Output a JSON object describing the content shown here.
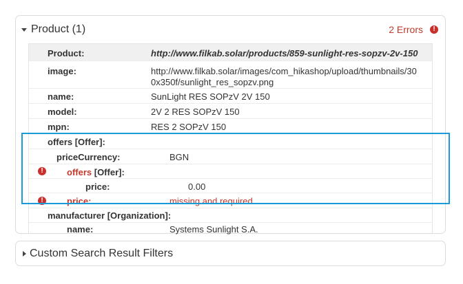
{
  "product_panel": {
    "title": "Product (1)",
    "errors_label": "2 Errors",
    "rows": {
      "product": {
        "label": "Product:",
        "value": "http://www.filkab.solar/products/859-sunlight-res-sopzv-2v-150"
      },
      "image": {
        "label": "image:",
        "value_line1": "http://www.filkab.solar/images/com_hikashop/upload/thumbnails/30",
        "value_line2": "0x350f/sunlight_res_sopzv.png"
      },
      "name": {
        "label": "name:",
        "value": "SunLight RES SOPzV 2V 150"
      },
      "model": {
        "label": "model:",
        "value": "2V 2 RES SOPzV 150"
      },
      "mpn": {
        "label": "mpn:",
        "value": "RES 2 SOPzV 150"
      },
      "offers": {
        "label": "offers [Offer]:"
      },
      "price_currency": {
        "label": "priceCurrency:",
        "value": "BGN"
      },
      "nested_offers": {
        "label_red": "offers",
        "label_rest": " [Offer]:"
      },
      "nested_price": {
        "label": "price:",
        "value": "0.00"
      },
      "price_error": {
        "label": "price:",
        "value": "missing and required"
      },
      "manufacturer": {
        "label": "manufacturer [Organization]:"
      },
      "manufacturer_name": {
        "label": "name:",
        "value": "Systems Sunlight S.A."
      }
    }
  },
  "filters_panel": {
    "title": "Custom Search Result Filters"
  },
  "colors": {
    "error": "#c0392b",
    "highlight": "#1a9bd7"
  },
  "icons": {
    "error_icon": "!"
  }
}
